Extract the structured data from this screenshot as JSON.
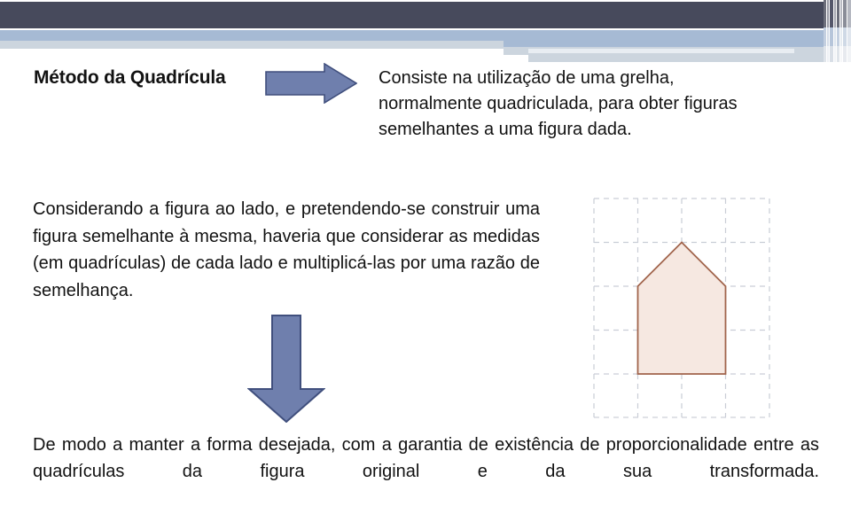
{
  "slide": {
    "title": "Método da Quadrícula",
    "intro_paragraph": "Consiste na utilização de uma grelha, normalmente quadriculada, para obter figuras semelhantes a uma figura dada.",
    "body_paragraph": "Considerando a figura ao lado, e pretendendo-se construir uma figura semelhante à mesma, haveria que considerar as medidas (em quadrículas) de cada lado e multiplicá-las por uma razão de semelhança.",
    "footer_paragraph": "De modo a manter a forma desejada, com a garantia de existência de proporcionalidade entre as quadrículas da figura original e da sua transformada."
  },
  "arrows": {
    "right_arrow_name": "arrow-right-icon",
    "down_arrow_name": "arrow-down-icon",
    "fill": "#6f7fad",
    "stroke": "#404f7d"
  },
  "figure": {
    "caption": "",
    "shape_name": "house-pentagon",
    "shape_fill": "#f6e8e1",
    "shape_stroke": "#a1644c",
    "grid_line_color": "#c9cdd6",
    "grid_columns": 4,
    "grid_rows": 5,
    "cell_size_px": 49,
    "shape_width_cells": 2,
    "shape_body_height_cells": 2,
    "shape_roof_height_cells": 1
  },
  "theme": {
    "band_dark": "#474a5c",
    "band_blue": "#a6bad4",
    "band_pale": "#ccd5de",
    "band_light": "#e8edf2",
    "background": "#ffffff",
    "text_color": "#121212"
  }
}
